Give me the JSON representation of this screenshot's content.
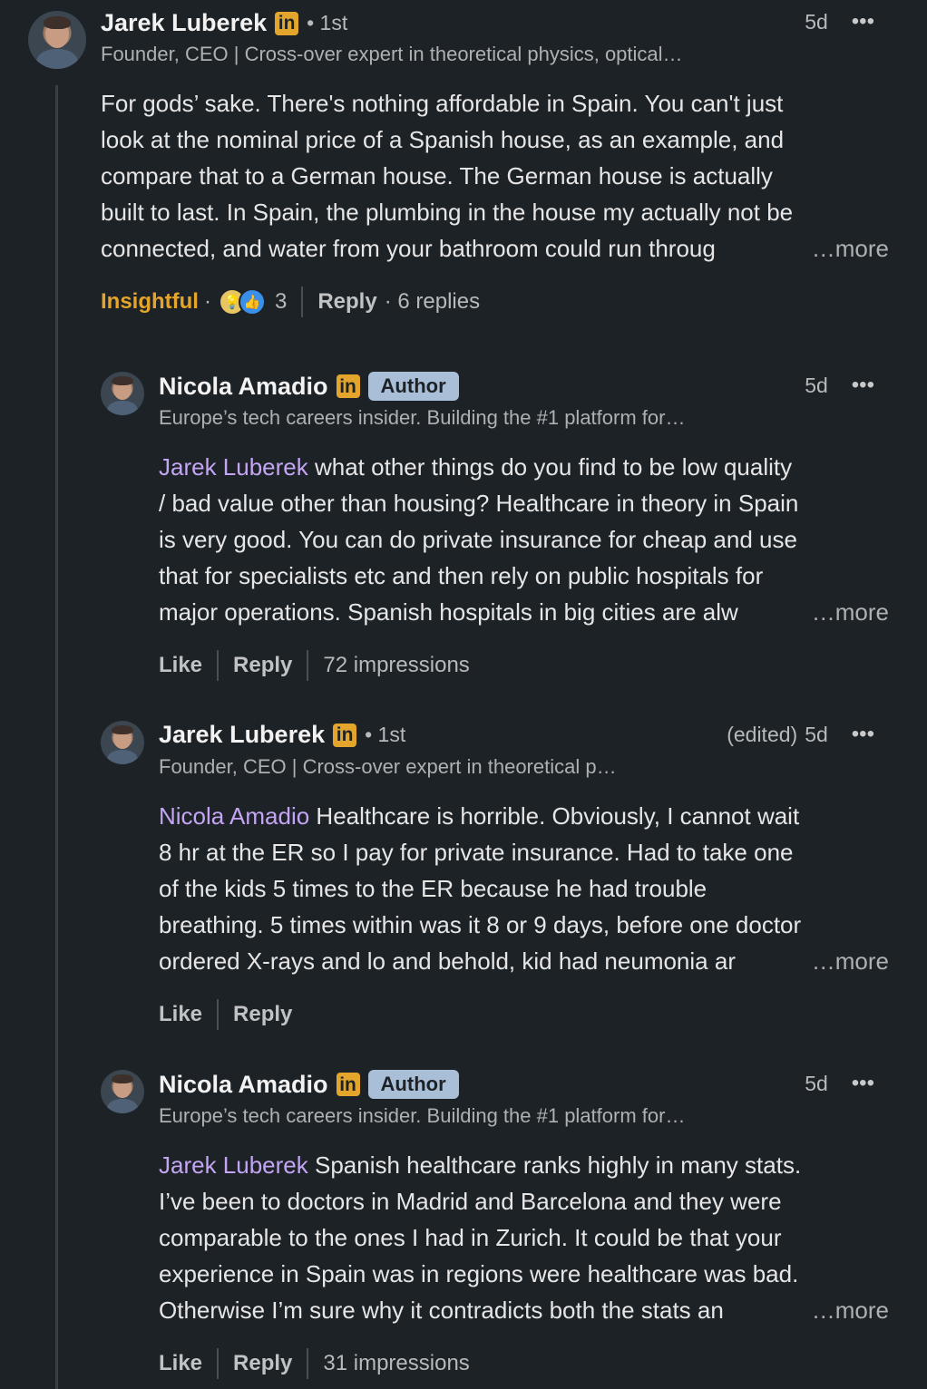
{
  "comments": [
    {
      "name": "Jarek Luberek",
      "degree": "• 1st",
      "headline": "Founder, CEO | Cross-over expert in theoretical physics, optical…",
      "time": "5d",
      "body_lines": [
        "For gods’ sake. There's nothing affordable in Spain. You can't just",
        "look at the nominal price of a Spanish house, as an example, and",
        "compare that to a German house. The German house is actually",
        "built to last. In Spain, the plumbing in the house my actually not be",
        "connected, and water from your bathroom could run throug"
      ],
      "see_more": "…more",
      "reaction_label": "Insightful",
      "reaction_count": "3",
      "reply": "Reply",
      "replies": "· 6 replies"
    },
    {
      "name": "Nicola Amadio",
      "badge": "Author",
      "headline": "Europe’s tech careers insider. Building the #1 platform for…",
      "time": "5d",
      "mention": "Jarek Luberek",
      "body_first": " what other things do you find to be low quality",
      "body_lines": [
        "/ bad value other than housing? Healthcare in theory in Spain",
        "is very good. You can do private insurance for cheap and use",
        "that for specialists etc and then rely on public hospitals for",
        "major operations. Spanish hospitals in big cities are alw"
      ],
      "see_more": "…more",
      "like": "Like",
      "reply": "Reply",
      "impressions": "72 impressions"
    },
    {
      "name": "Jarek Luberek",
      "degree": "• 1st",
      "edited": "(edited)",
      "headline": "Founder, CEO | Cross-over expert in theoretical p…",
      "time": "5d",
      "mention": "Nicola Amadio",
      "body_first": " Healthcare is horrible. Obviously, I cannot wait",
      "body_lines": [
        "8 hr at the ER so I pay for private insurance. Had to take one",
        "of the kids 5 times to the ER because he had trouble",
        "breathing. 5 times within was it 8 or 9 days, before one doctor",
        "ordered X-rays and lo and behold, kid had neumonia ar"
      ],
      "see_more": "…more",
      "like": "Like",
      "reply": "Reply"
    },
    {
      "name": "Nicola Amadio",
      "badge": "Author",
      "headline": "Europe’s tech careers insider. Building the #1 platform for…",
      "time": "5d",
      "mention": "Jarek Luberek",
      "body_first": " Spanish healthcare ranks highly in many stats.",
      "body_lines": [
        "I’ve been to doctors in Madrid and Barcelona and they were",
        "comparable to the ones I had in Zurich. It could be that your",
        "experience in Spain was in regions were healthcare was bad.",
        "Otherwise I’m sure why it contradicts both the stats an"
      ],
      "see_more": "…more",
      "like": "Like",
      "reply": "Reply",
      "impressions": "31 impressions"
    }
  ],
  "icons": {
    "linkedin": "in",
    "more": "•••",
    "insightful": "lightbulb-icon",
    "like": "thumbs-up-icon"
  },
  "colors": {
    "background": "#1d2226",
    "mention": "#c4a5f4",
    "insightful": "#e3a52b",
    "author_badge": "#a9bfd7"
  }
}
